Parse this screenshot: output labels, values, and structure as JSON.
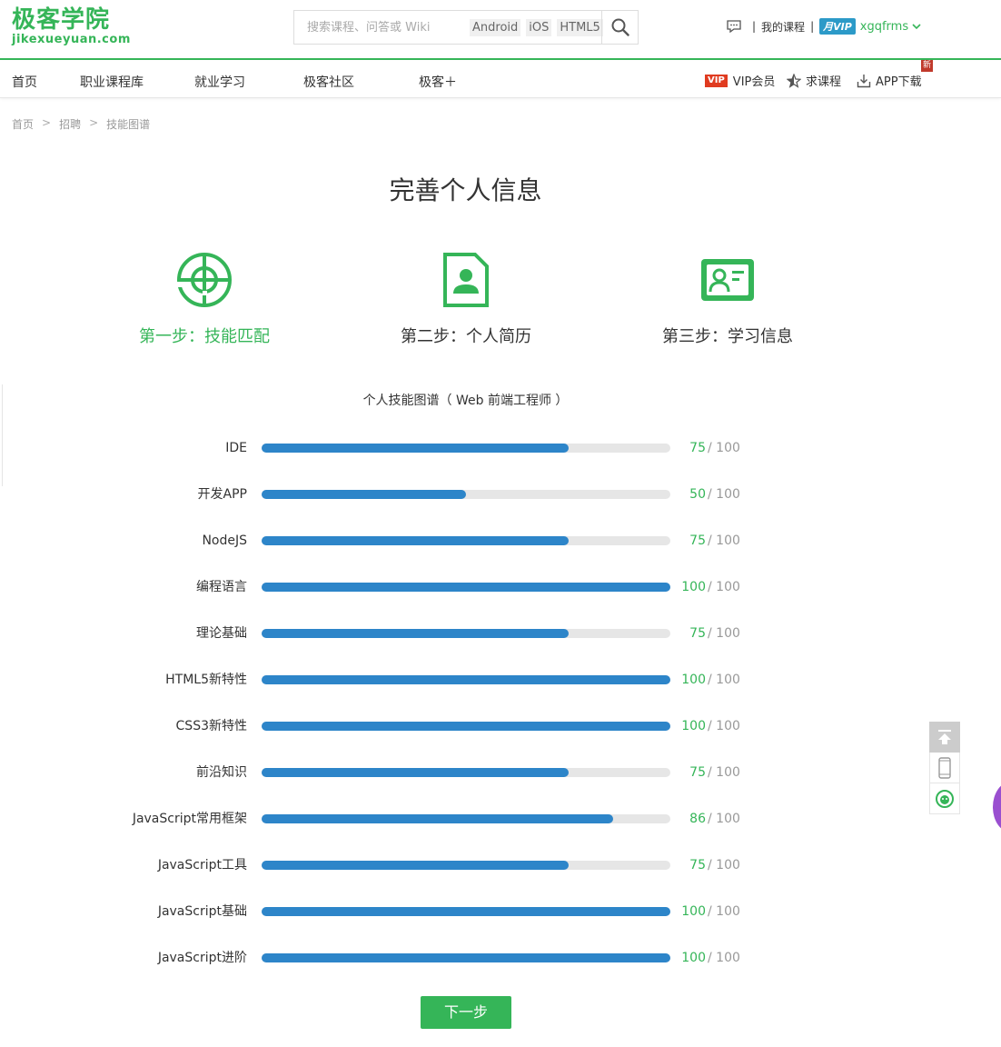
{
  "logo": {
    "cn": "极客学院",
    "en": "jikexueyuan.com"
  },
  "search": {
    "placeholder": "搜索课程、问答或 Wiki",
    "tags": [
      "Android",
      "iOS",
      "HTML5"
    ]
  },
  "user": {
    "my_courses": "我的课程",
    "vip_label": "月VIP",
    "username": "xgqfrms"
  },
  "nav": {
    "items": [
      "首页",
      "职业课程库",
      "就业学习",
      "极客社区",
      "极客＋"
    ],
    "vip_tag": "VIP",
    "vip_member": "VIP会员",
    "request_course": "求课程",
    "app_download": "APP下载",
    "new_tag": "新"
  },
  "breadcrumb": [
    "首页",
    "招聘",
    "技能图谱"
  ],
  "breadcrumb_sep": ">",
  "page_title": "完善个人信息",
  "steps": [
    {
      "label": "第一步：技能匹配",
      "active": true,
      "icon": "target-icon"
    },
    {
      "label": "第二步：个人简历",
      "active": false,
      "icon": "resume-icon"
    },
    {
      "label": "第三步：学习信息",
      "active": false,
      "icon": "id-card-icon"
    }
  ],
  "chart_title": "个人技能图谱（ Web 前端工程师 ）",
  "chart_data": {
    "type": "bar",
    "orientation": "horizontal",
    "title": "个人技能图谱（ Web 前端工程师 ）",
    "max_label": "/ 100",
    "xlim": [
      0,
      100
    ],
    "categories": [
      "IDE",
      "开发APP",
      "NodeJS",
      "编程语言",
      "理论基础",
      "HTML5新特性",
      "CSS3新特性",
      "前沿知识",
      "JavaScript常用框架",
      "JavaScript工具",
      "JavaScript基础",
      "JavaScript进阶"
    ],
    "values": [
      75,
      50,
      75,
      100,
      75,
      100,
      100,
      75,
      86,
      75,
      100,
      100
    ]
  },
  "next_button": "下一步",
  "colors": {
    "brand_green": "#35b558",
    "bar_blue": "#2d85c9",
    "track_gray": "#e6e6e6",
    "vip_blue": "#2c9ac8",
    "vip_red": "#e03b20"
  }
}
